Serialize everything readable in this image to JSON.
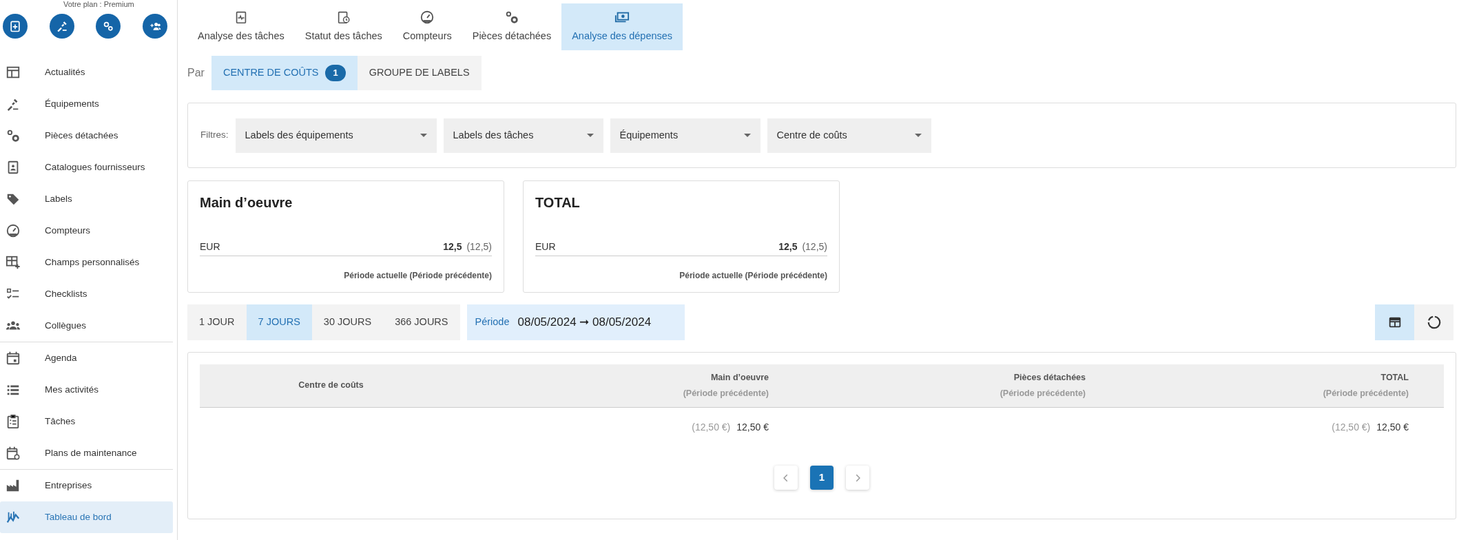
{
  "plan": {
    "text": "Votre plan : Premium"
  },
  "quick_actions": [
    {
      "kind": "task"
    },
    {
      "kind": "equipment"
    },
    {
      "kind": "parts"
    },
    {
      "kind": "colleagues"
    }
  ],
  "sidebar": {
    "groups": [
      {
        "items": [
          {
            "label": "Actualités",
            "selected": false
          },
          {
            "label": "Équipements",
            "selected": false
          },
          {
            "label": "Pièces détachées",
            "selected": false
          },
          {
            "label": "Catalogues fournisseurs",
            "selected": false
          },
          {
            "label": "Labels",
            "selected": false
          },
          {
            "label": "Compteurs",
            "selected": false
          },
          {
            "label": "Champs personnalisés",
            "selected": false
          },
          {
            "label": "Checklists",
            "selected": false
          },
          {
            "label": "Collègues",
            "selected": false
          }
        ]
      },
      {
        "items": [
          {
            "label": "Agenda",
            "selected": false
          },
          {
            "label": "Mes activités",
            "selected": false
          },
          {
            "label": "Tâches",
            "selected": false
          },
          {
            "label": "Plans de maintenance",
            "selected": false
          }
        ]
      },
      {
        "items": [
          {
            "label": "Entreprises",
            "selected": false
          },
          {
            "label": "Tableau de bord",
            "selected": true
          }
        ]
      }
    ]
  },
  "tabs": [
    {
      "label": "Analyse des tâches",
      "selected": false
    },
    {
      "label": "Statut des tâches",
      "selected": false
    },
    {
      "label": "Compteurs",
      "selected": false
    },
    {
      "label": "Pièces détachées",
      "selected": false
    },
    {
      "label": "Analyse des dépenses",
      "selected": true
    }
  ],
  "group_by": {
    "label": "Par",
    "options": [
      {
        "label": "CENTRE DE COÛTS",
        "badge": "1",
        "selected": true
      },
      {
        "label": "GROUPE DE LABELS",
        "selected": false
      }
    ]
  },
  "filters": {
    "label": "Filtres:",
    "dropdowns": [
      "Labels des équipements",
      "Labels des tâches",
      "Équipements",
      "Centre de coûts"
    ]
  },
  "summary_cards": [
    {
      "title": "Main d’oeuvre",
      "currency": "EUR",
      "current": "12,5",
      "previous": "(12,5)",
      "footnote": "Période actuelle (Période précédente)"
    },
    {
      "title": "TOTAL",
      "currency": "EUR",
      "current": "12,5",
      "previous": "(12,5)",
      "footnote": "Période actuelle (Période précédente)"
    }
  ],
  "ranges": [
    {
      "label": "1 JOUR",
      "selected": false
    },
    {
      "label": "7 JOURS",
      "selected": true
    },
    {
      "label": "30 JOURS",
      "selected": false
    },
    {
      "label": "366 JOURS",
      "selected": false
    }
  ],
  "period": {
    "label": "Période",
    "value": "08/05/2024 ➞ 08/05/2024"
  },
  "view_toggle": [
    {
      "kind": "table",
      "selected": true
    },
    {
      "kind": "donut",
      "selected": false
    }
  ],
  "table": {
    "columns": [
      {
        "title": "Centre de coûts"
      },
      {
        "title": "Main d’oeuvre",
        "subtitle": "(Période précédente)"
      },
      {
        "title": "Pièces détachées",
        "subtitle": "(Période précédente)"
      },
      {
        "title": "TOTAL",
        "subtitle": "(Période précédente)"
      }
    ],
    "rows": [
      {
        "cells": [
          {},
          {
            "previous": "(12,50 €)",
            "value": "12,50 €"
          },
          {},
          {
            "previous": "(12,50 €)",
            "value": "12,50 €"
          }
        ]
      }
    ]
  },
  "pagination": {
    "pages": [
      {
        "label": "1",
        "selected": true
      }
    ]
  }
}
